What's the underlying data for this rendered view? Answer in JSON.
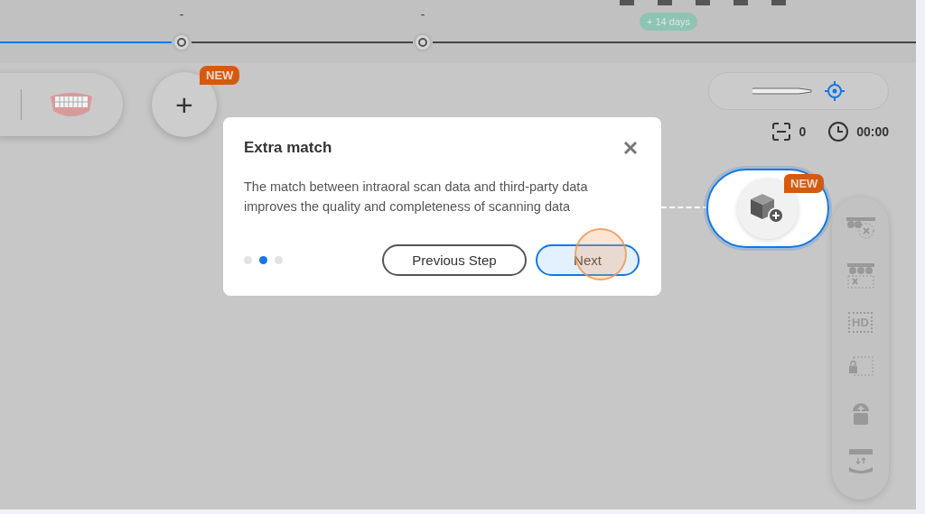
{
  "header": {
    "trial_badge": "+ 14 days"
  },
  "timeline": {
    "nodes": [
      {
        "label": "-"
      },
      {
        "label": "-"
      }
    ]
  },
  "add_button": {
    "label": "+",
    "badge": "NEW"
  },
  "scan_status": {
    "count": "0",
    "timer": "00:00"
  },
  "guide": {
    "title": "Extra match",
    "description": "The match between intraoral scan data and third-party data improves the quality and completeness of scanning data",
    "steps": [
      {
        "selected": false
      },
      {
        "selected": true
      },
      {
        "selected": false
      }
    ],
    "buttons": [
      {
        "label": "Previous Step",
        "kind": "outline"
      },
      {
        "label": "Next",
        "kind": "primary"
      }
    ]
  },
  "highlighted_tool": {
    "badge": "NEW"
  },
  "tool_rail": {
    "items": [
      {
        "kind": "remove"
      },
      {
        "kind": "crop"
      },
      {
        "kind": "hd",
        "label": "HD"
      },
      {
        "kind": "lock"
      },
      {
        "kind": "upload"
      },
      {
        "kind": "bite"
      }
    ]
  }
}
